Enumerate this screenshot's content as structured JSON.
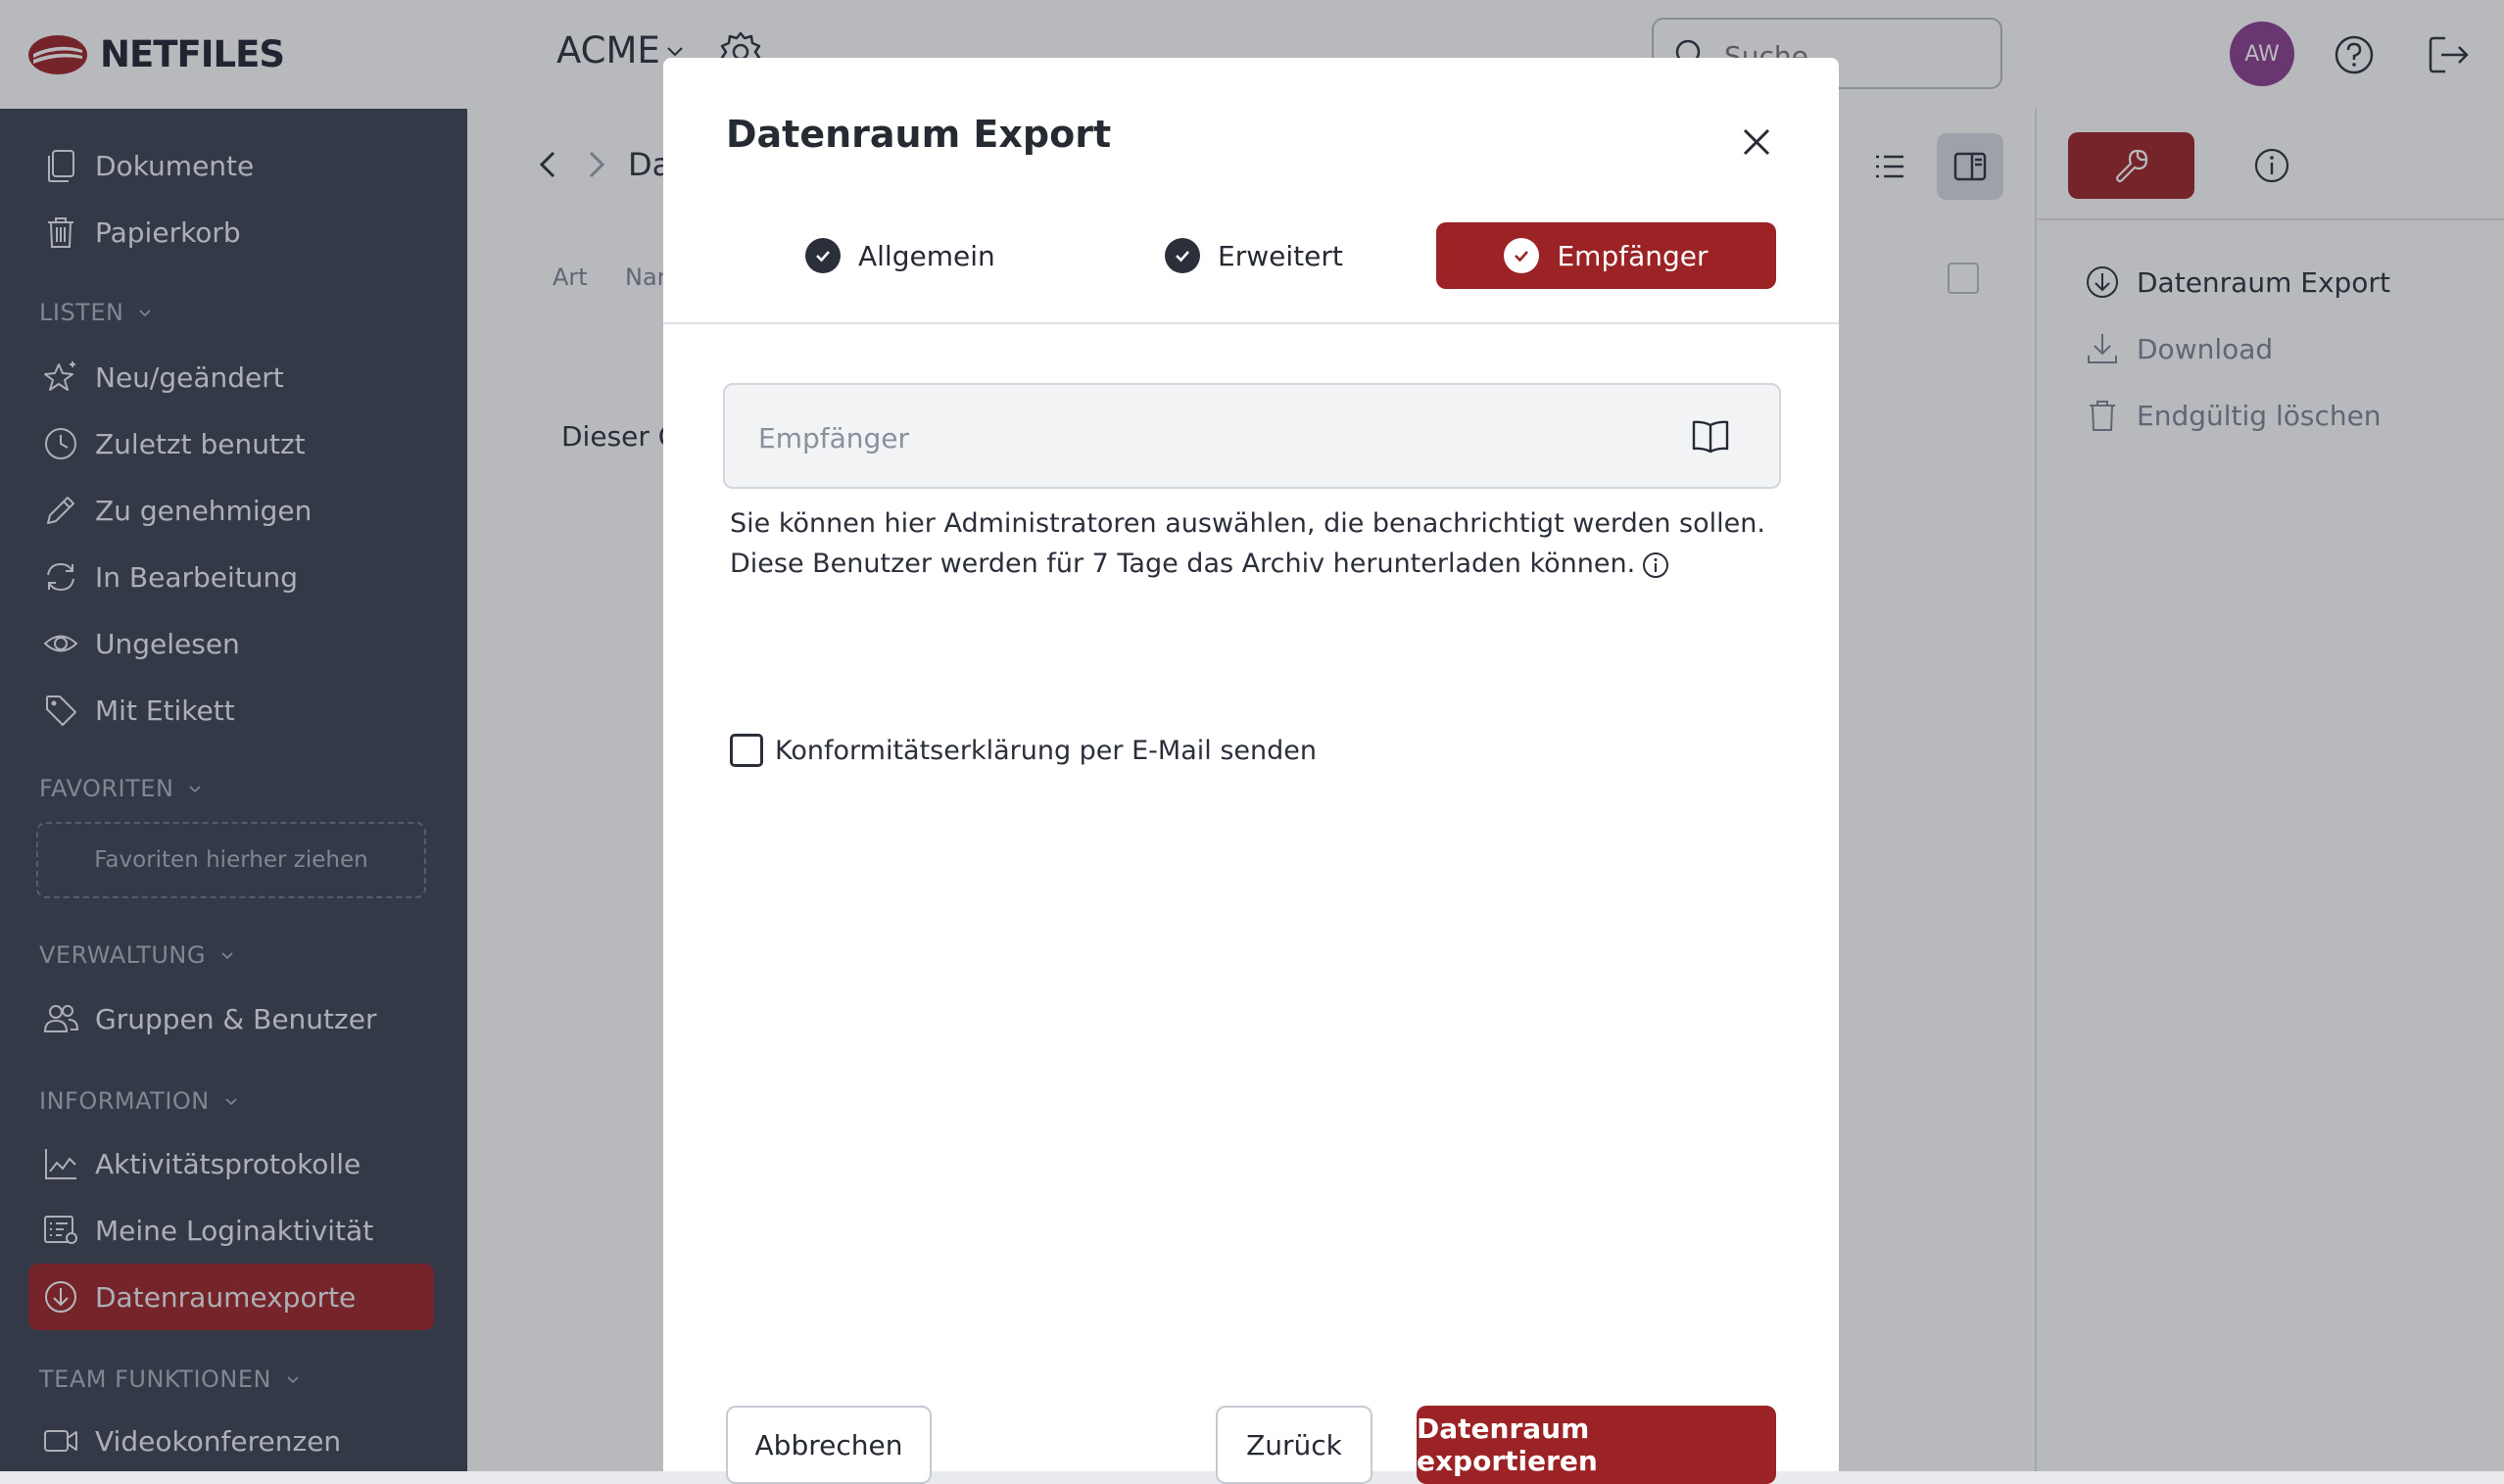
{
  "brand": {
    "name": "NETFILES",
    "accent": "#9b2325",
    "sidebar_bg": "#394150"
  },
  "header": {
    "workspace": "ACME",
    "search_placeholder": "Suche",
    "avatar_initials": "AW"
  },
  "sidebar": {
    "top_items": [
      {
        "label": "Dokumente",
        "icon": "documents-icon"
      },
      {
        "label": "Papierkorb",
        "icon": "trash-icon"
      }
    ],
    "sections": {
      "lists": "LISTEN",
      "favorites": "FAVORITEN",
      "admin": "VERWALTUNG",
      "information": "INFORMATION",
      "team": "TEAM FUNKTIONEN"
    },
    "list_items": [
      {
        "label": "Neu/geändert"
      },
      {
        "label": "Zuletzt benutzt"
      },
      {
        "label": "Zu genehmigen"
      },
      {
        "label": "In Bearbeitung"
      },
      {
        "label": "Ungelesen"
      },
      {
        "label": "Mit Etikett"
      }
    ],
    "favorites_drop": "Favoriten hierher ziehen",
    "admin_items": [
      {
        "label": "Gruppen & Benutzer"
      }
    ],
    "info_items": [
      {
        "label": "Aktivitätsprotokolle"
      },
      {
        "label": "Meine Loginaktivität"
      },
      {
        "label": "Datenraumexporte",
        "active": true
      }
    ],
    "team_items": [
      {
        "label": "Videokonferenzen"
      }
    ]
  },
  "main": {
    "breadcrumb": "Da",
    "columns": [
      "Art",
      "Nar"
    ],
    "empty_text": "Dieser C"
  },
  "right_panel": {
    "actions": [
      {
        "label": "Datenraum Export",
        "enabled": true
      },
      {
        "label": "Download",
        "enabled": false
      },
      {
        "label": "Endgültig löschen",
        "enabled": false
      }
    ]
  },
  "modal": {
    "title": "Datenraum Export",
    "steps": [
      {
        "label": "Allgemein",
        "state": "done"
      },
      {
        "label": "Erweitert",
        "state": "done"
      },
      {
        "label": "Empfänger",
        "state": "active"
      }
    ],
    "recipient_placeholder": "Empfänger",
    "hint": "Sie können hier Administratoren auswählen, die benachrichtigt werden sollen. Diese Benutzer werden für 7 Tage das Archiv herunterladen können.",
    "confirm_label": "Konformitätserklärung per E-Mail senden",
    "confirm_checked": false,
    "buttons": {
      "cancel": "Abbrechen",
      "back": "Zurück",
      "export": "Datenraum exportieren"
    }
  }
}
